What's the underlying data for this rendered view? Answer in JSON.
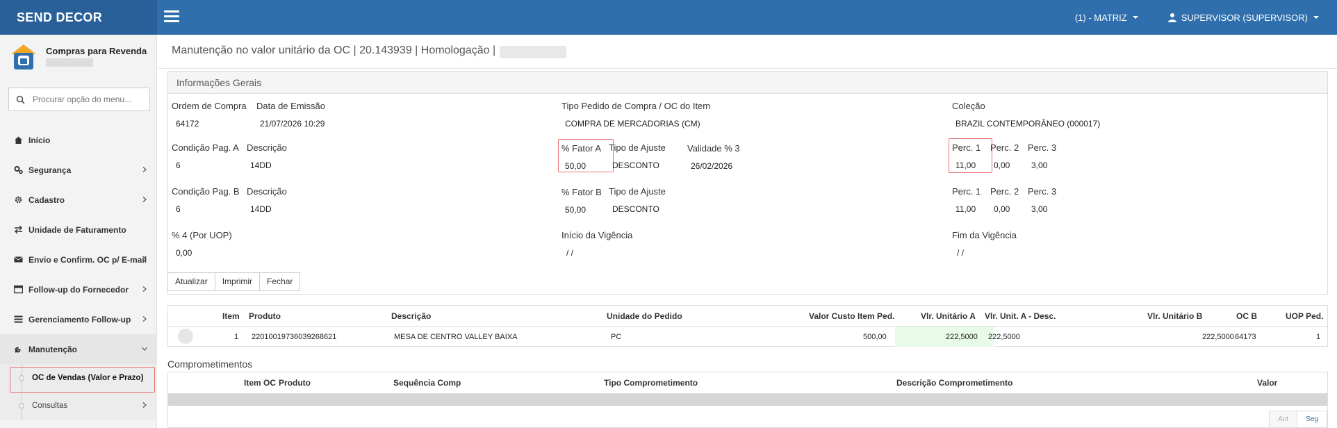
{
  "app": {
    "brand": "SEND DECOR"
  },
  "header": {
    "branch": "(1) - MATRIZ",
    "user": "SUPERVISOR (SUPERVISOR)"
  },
  "sidebar": {
    "module_title": "Compras para Revenda",
    "search_placeholder": "Procurar opção do menu...",
    "items": [
      {
        "label": "Início"
      },
      {
        "label": "Segurança"
      },
      {
        "label": "Cadastro"
      },
      {
        "label": "Unidade de Faturamento"
      },
      {
        "label": "Envio e Confirm. OC p/ E-mail"
      },
      {
        "label": "Follow-up do Fornecedor"
      },
      {
        "label": "Gerenciamento Follow-up"
      },
      {
        "label": "Manutenção"
      }
    ],
    "submenu": [
      {
        "label": "OC de Vendas (Valor e Prazo)"
      },
      {
        "label": "Consultas"
      }
    ]
  },
  "page": {
    "title": "Manutenção no valor unitário da OC | 20.143939 | Homologação |"
  },
  "panel": {
    "title": "Informações Gerais",
    "labels": {
      "ordem": "Ordem de Compra",
      "data_emissao": "Data de Emissão",
      "tipo_pedido": "Tipo Pedido de Compra / OC do Item",
      "colecao": "Coleção",
      "cond_a": "Condição Pag. A",
      "descricao": "Descrição",
      "fator_a": "% Fator A",
      "tipo_ajuste": "Tipo de Ajuste",
      "validade3": "Validade % 3",
      "perc1": "Perc. 1",
      "perc2": "Perc. 2",
      "perc3": "Perc. 3",
      "cond_b": "Condição Pag. B",
      "fator_b": "% Fator B",
      "perc4": "% 4 (Por UOP)",
      "inicio_vigencia": "Início da Vigência",
      "fim_vigencia": "Fim da Vigência"
    },
    "values": {
      "ordem": "64172",
      "data_emissao": "21/07/2026 10:29",
      "tipo_pedido": "COMPRA DE MERCADORIAS (CM)",
      "colecao": "BRAZIL CONTEMPORÂNEO (000017)",
      "cond_a": "6",
      "desc_a": "14DD",
      "fator_a": "50,00",
      "tipo_ajuste_a": "DESCONTO",
      "validade3": "26/02/2026",
      "perc1_a": "11,00",
      "perc2_a": "0,00",
      "perc3_a": "3,00",
      "cond_b": "6",
      "desc_b": "14DD",
      "fator_b": "50,00",
      "tipo_ajuste_b": "DESCONTO",
      "perc1_b": "11,00",
      "perc2_b": "0,00",
      "perc3_b": "3,00",
      "perc4": "0,00",
      "inicio_vigencia": "/ /",
      "fim_vigencia": "/ /"
    }
  },
  "buttons": {
    "atualizar": "Atualizar",
    "imprimir": "Imprimir",
    "fechar": "Fechar"
  },
  "items_grid": {
    "columns": [
      "Item",
      "Produto",
      "Descrição",
      "Unidade do Pedido",
      "Valor Custo Item Ped.",
      "Vlr. Unitário A",
      "Vlr. Unit. A - Desc.",
      "Vlr. Unitário B",
      "OC B",
      "UOP Ped."
    ],
    "rows": [
      {
        "item": "1",
        "produto": "220100197360392686​21",
        "descricao": "MESA DE CENTRO VALLEY BAIXA",
        "unidade": "PC",
        "custo": "500,00",
        "vlr_a": "222,5000",
        "vlr_a_desc": "222,5000",
        "vlr_b": "222,5000",
        "oc_b": "64173",
        "uop": "1"
      }
    ]
  },
  "comprometimentos": {
    "title": "Comprometimentos",
    "columns": [
      "Item OC",
      "Produto",
      "Sequência Comp",
      "Tipo Comprometimento",
      "Descrição Comprometimento",
      "Valor"
    ],
    "pager": {
      "prev": "Ant",
      "next": "Seg"
    }
  },
  "colors": {
    "topbar": "#2f6fad",
    "brand_bg": "#29609a",
    "highlight_border": "#e57373",
    "highlight_cell": "#e8fae8"
  }
}
